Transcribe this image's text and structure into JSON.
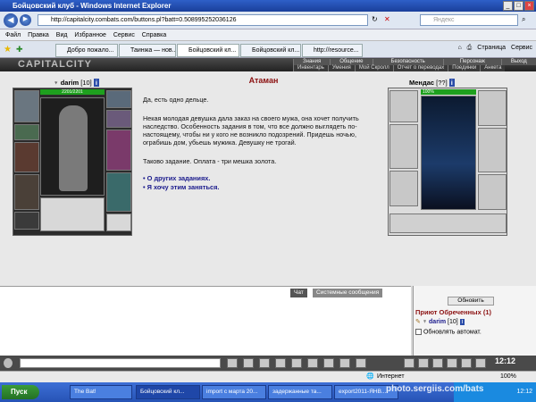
{
  "window": {
    "title": "Бойцовский клуб - Windows Internet Explorer"
  },
  "address": {
    "url": "http://capitalcity.combats.com/buttons.pl?batt=0.508995252036126",
    "search_placeholder": "Яндекс"
  },
  "menu": [
    "Файл",
    "Правка",
    "Вид",
    "Избранное",
    "Сервис",
    "Справка"
  ],
  "tabs": [
    "Добро пожало...",
    "Таинжа — нов...",
    "Бойцовский кл...",
    "Бойцовский кл...",
    "http://resource..."
  ],
  "tools": [
    "Страница",
    "Сервис"
  ],
  "game": {
    "logo": "CAPITALCITY",
    "menu1": [
      "Знания",
      "Общение",
      "Безопасность",
      "Персонаж",
      "Выход"
    ],
    "menu2": [
      "Инвентарь",
      "Умения",
      "Мой Скролл",
      "Отчет о переводах",
      "Поединки",
      "Анкета"
    ]
  },
  "player": {
    "name": "darim",
    "level": "[10]",
    "hp": "2201/2201"
  },
  "npc": {
    "name": "Мендас",
    "level": "[??]",
    "hp": "100%"
  },
  "dialog": {
    "title": "Атаман",
    "greeting": "Да, есть одно дельце.",
    "story": "Некая молодая девушка дала заказ на своего мужа, она хочет получить наследство. Особенность задания в том, что все должно выглядеть по-настоящему, чтобы ни у кого не возникло подозрений. Придешь ночью, ограбишь дом, убьешь мужика. Девушку не трогай.",
    "offer": "Таково задание. Оплата - три мешка золота.",
    "options": [
      "• О других заданиях.",
      "• Я хочу этим заняться."
    ]
  },
  "chat": {
    "tabs": [
      "Чат",
      "Системные сообщения"
    ]
  },
  "room": {
    "refresh_button": "Обновить",
    "title": "Приют Обреченных (1)",
    "user": "darim",
    "user_level": "[10]",
    "auto_label": "Обновлять автомат."
  },
  "clock": "12:12",
  "status": {
    "zone": "Интернет",
    "zoom": "100%"
  },
  "taskbar": {
    "start": "Пуск",
    "items": [
      "The Bat!",
      "Бойцовский кл...",
      "import с марта 20...",
      "задержанные та...",
      "export2011-ЯНВ..."
    ],
    "tray_time": "12:12"
  },
  "watermark": "photo.sergiis.com/bats"
}
